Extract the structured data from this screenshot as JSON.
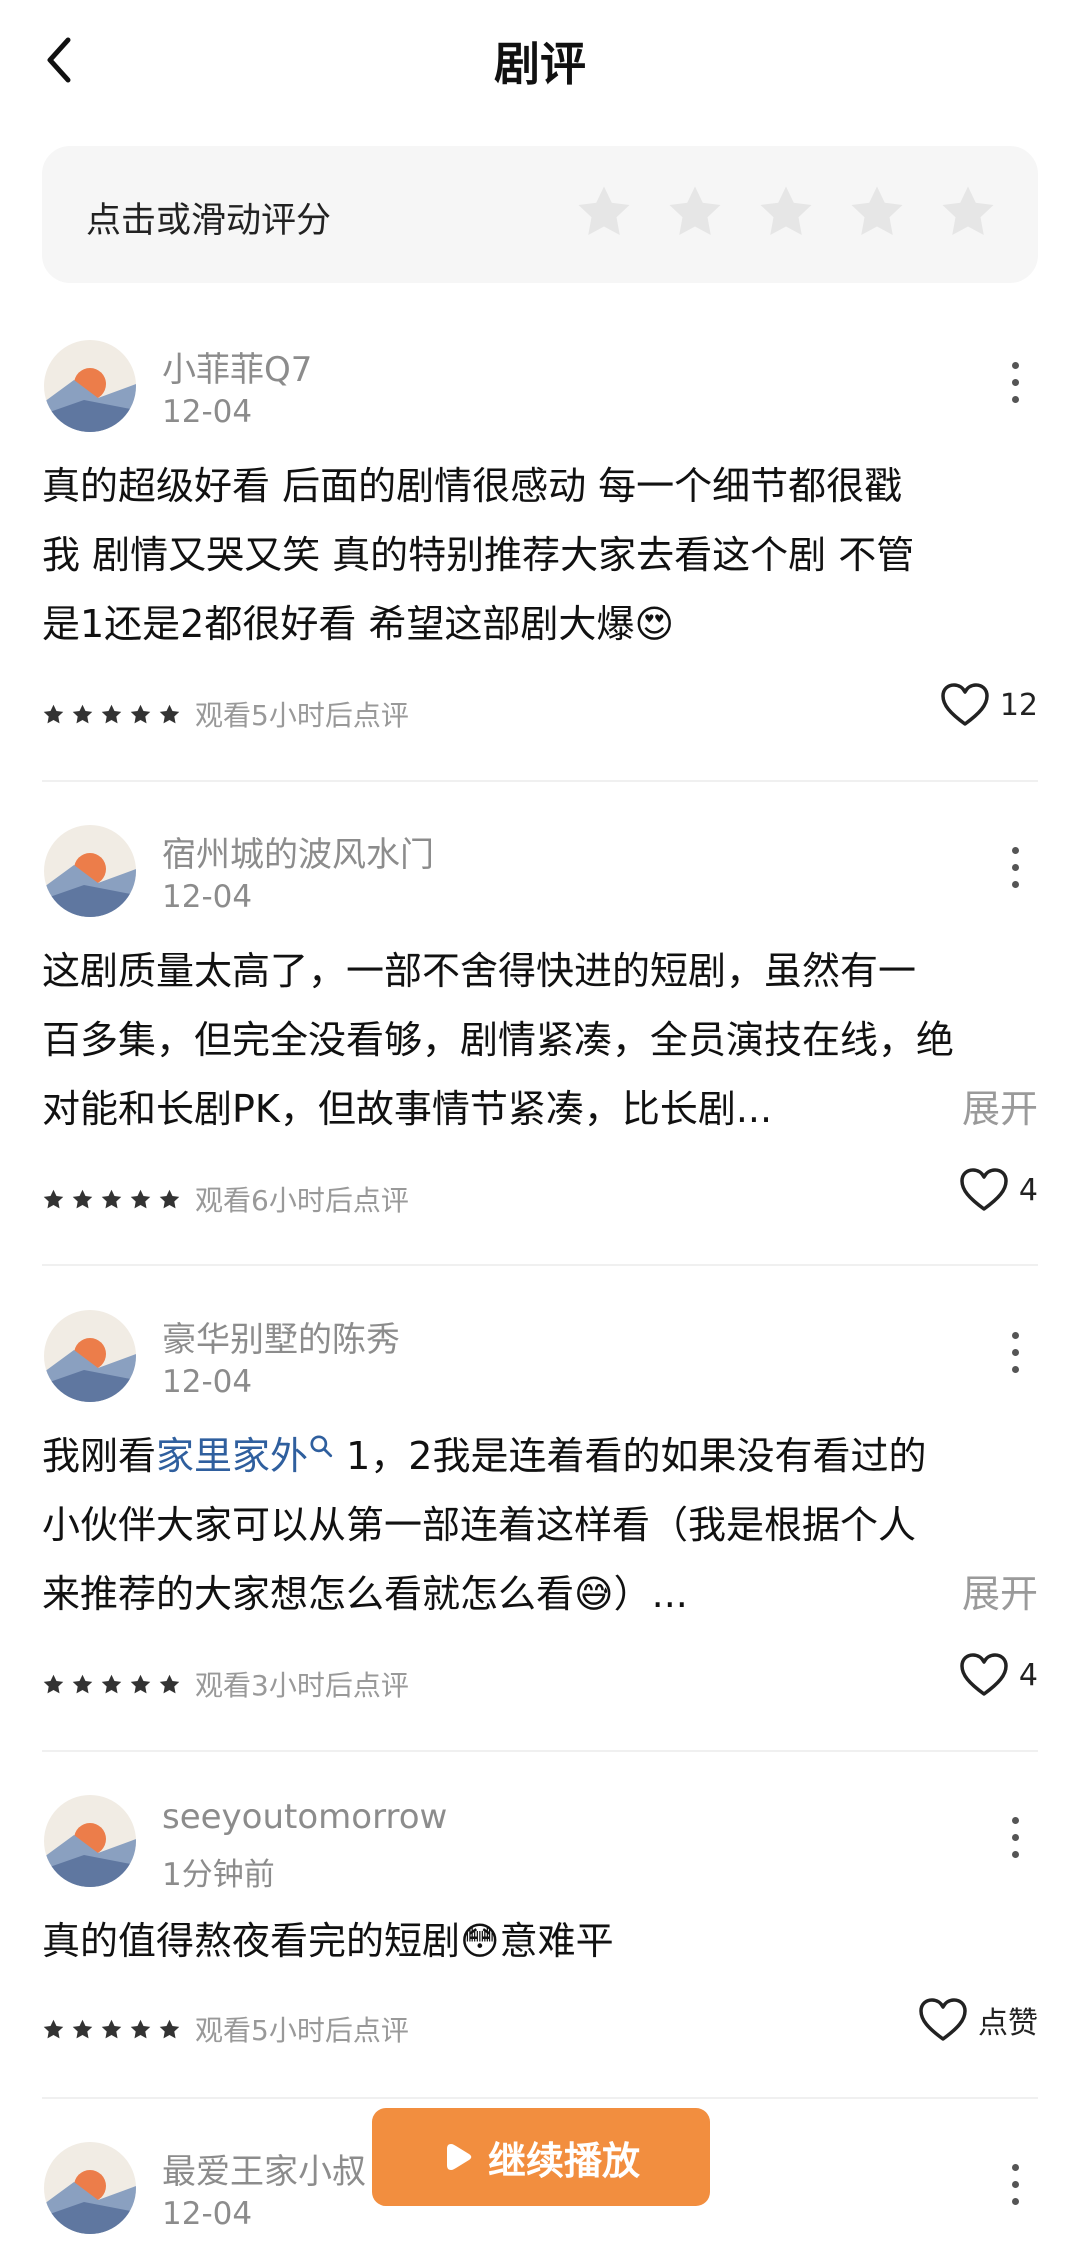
{
  "header": {
    "title": "剧评"
  },
  "rating": {
    "label": "点击或滑动评分",
    "stars": 5
  },
  "reviews": [
    {
      "username": "小菲菲Q7",
      "date": "12-04",
      "text_lines": [
        "真的超级好看 后面的剧情很感动 每一个细节都很戳",
        "我 剧情又哭又笑 真的特别推荐大家去看这个剧 不管",
        "是1还是2都很好看 希望这部剧大爆"
      ],
      "emoji": "😍",
      "watch_note": "观看5小时后点评",
      "likes": "12",
      "stars": 5
    },
    {
      "username": "宿州城的波风水门",
      "date": "12-04",
      "text_lines": [
        "这剧质量太高了，一部不舍得快进的短剧，虽然有一",
        "百多集，但完全没看够，剧情紧凑，全员演技在线，绝",
        "对能和长剧PK，但故事情节紧凑，比长剧..."
      ],
      "expand": "展开",
      "watch_note": "观看6小时后点评",
      "likes": "4",
      "stars": 5
    },
    {
      "username": "豪华别墅的陈秀",
      "date": "12-04",
      "line1_prefix": "我刚看",
      "keyword": "家里家外",
      "line1_suffix": " 1，2我是连着看的如果没有看过的",
      "line2": "小伙伴大家可以从第一部连着这样看（我是根据个人",
      "line3_prefix": "来推荐的大家想怎么看就怎么看",
      "emoji": "😅",
      "line3_suffix": "）...",
      "expand": "展开",
      "watch_note": "观看3小时后点评",
      "likes": "4",
      "stars": 5
    },
    {
      "username": "seeyoutomorrow",
      "date": "1分钟前",
      "text_prefix": "真的值得熬夜看完的短剧",
      "emoji": "😳",
      "text_suffix": "意难平",
      "watch_note": "观看5小时后点评",
      "likes": "点赞",
      "stars": 5
    },
    {
      "username": "最爱王家小叔",
      "date": "12-04"
    }
  ],
  "continue_button": {
    "label": "继续播放"
  },
  "colors": {
    "accent": "#f28e3f",
    "link": "#2f5f9e",
    "muted": "#8c8c8c"
  }
}
